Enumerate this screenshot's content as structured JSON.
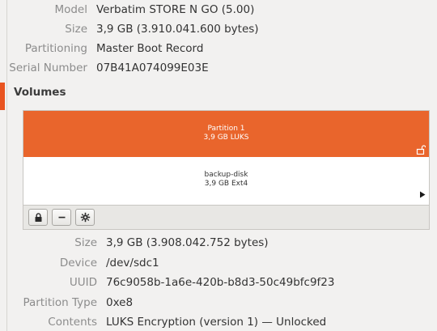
{
  "drive": {
    "properties": [
      {
        "label": "Model",
        "value": "Verbatim STORE N GO (5.00)"
      },
      {
        "label": "Size",
        "value": "3,9 GB (3.910.041.600 bytes)"
      },
      {
        "label": "Partitioning",
        "value": "Master Boot Record"
      },
      {
        "label": "Serial Number",
        "value": "07B41A074099E03E"
      }
    ]
  },
  "volumes": {
    "title": "Volumes",
    "partition": {
      "name": "Partition 1",
      "detail": "3,9 GB LUKS"
    },
    "filesystem": {
      "name": "backup-disk",
      "detail": "3,9 GB Ext4"
    },
    "toolbar": {
      "lock_icon": "lock-icon",
      "minus_icon": "minus-icon",
      "gear_icon": "gear-icon"
    }
  },
  "selected_volume": {
    "properties": [
      {
        "label": "Size",
        "value": "3,9 GB (3.908.042.752 bytes)"
      },
      {
        "label": "Device",
        "value": "/dev/sdc1"
      },
      {
        "label": "UUID",
        "value": "76c9058b-1a6e-420b-b8d3-50c49bfc9f23"
      },
      {
        "label": "Partition Type",
        "value": "0xe8"
      },
      {
        "label": "Contents",
        "value": "LUKS Encryption (version 1) — Unlocked"
      }
    ]
  },
  "colors": {
    "accent": "#e9652c",
    "selection": "#e95420"
  }
}
